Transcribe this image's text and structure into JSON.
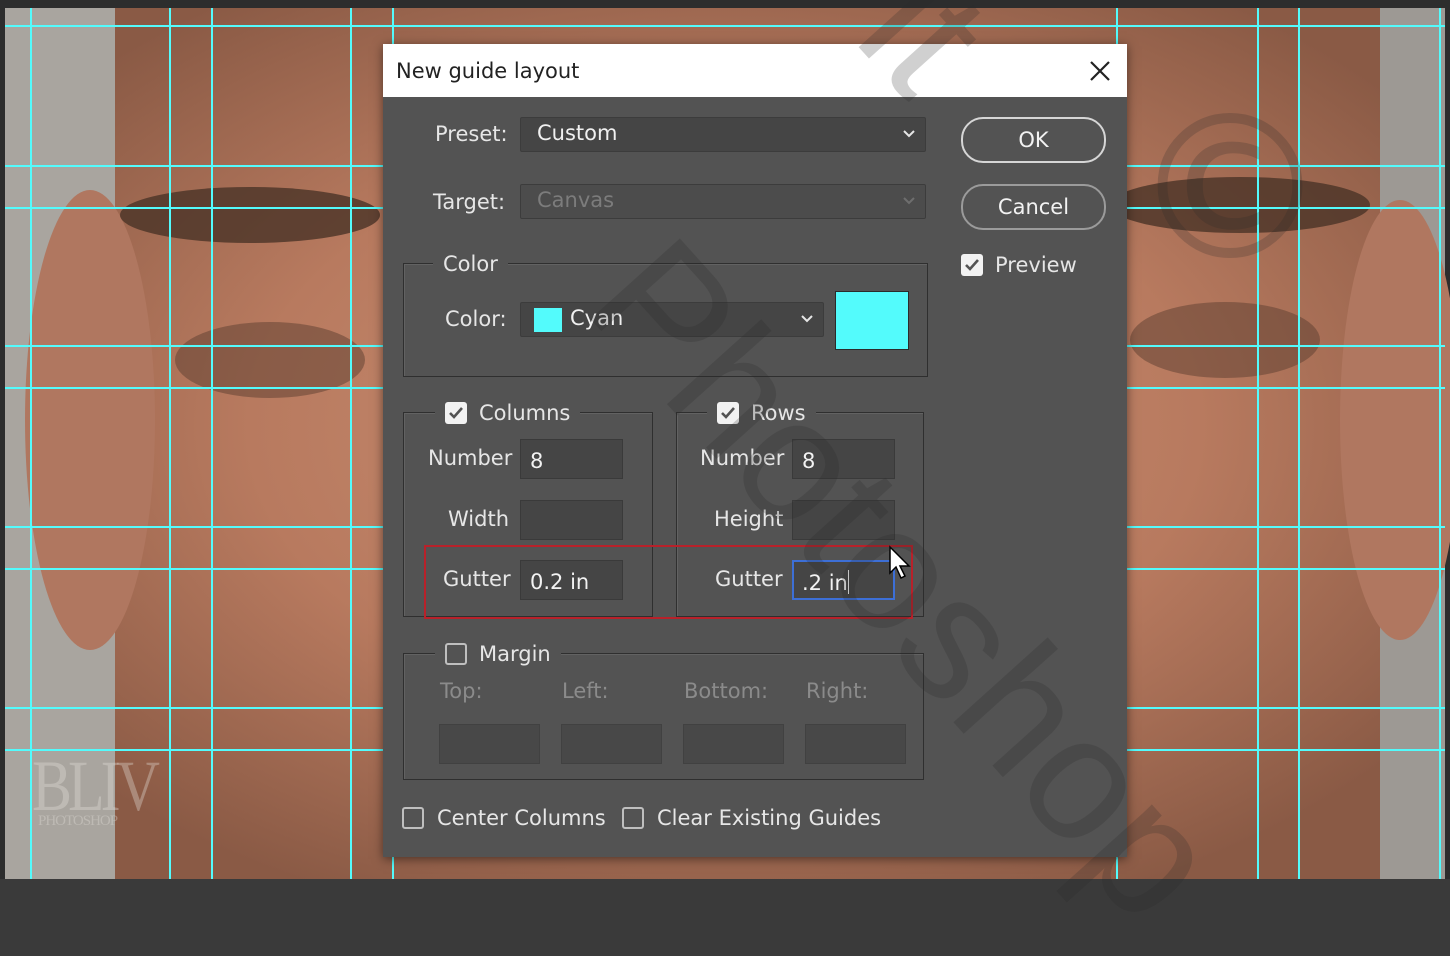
{
  "dialog": {
    "title": "New guide layout",
    "preset": {
      "label": "Preset:",
      "value": "Custom"
    },
    "target": {
      "label": "Target:",
      "value": "Canvas",
      "disabled": true
    },
    "color_group": {
      "legend": "Color",
      "label": "Color:",
      "value": "Cyan",
      "swatch_hex": "#53fbfc"
    },
    "columns": {
      "legend": "Columns",
      "checked": true,
      "number_label": "Number",
      "number_value": "8",
      "width_label": "Width",
      "width_value": "",
      "gutter_label": "Gutter",
      "gutter_value": "0.2 in"
    },
    "rows": {
      "legend": "Rows",
      "checked": true,
      "number_label": "Number",
      "number_value": "8",
      "height_label": "Height",
      "height_value": "",
      "gutter_label": "Gutter",
      "gutter_value": ".2 in"
    },
    "margin": {
      "legend": "Margin",
      "checked": false,
      "top_label": "Top:",
      "left_label": "Left:",
      "bottom_label": "Bottom:",
      "right_label": "Right:"
    },
    "center_columns": {
      "label": "Center Columns",
      "checked": false
    },
    "clear_existing": {
      "label": "Clear Existing Guides",
      "checked": false
    },
    "ok_label": "OK",
    "cancel_label": "Cancel",
    "preview": {
      "label": "Preview",
      "checked": true
    }
  },
  "canvas": {
    "guide_color": "#53fbfc"
  },
  "logo": {
    "line1": "BLIV",
    "line2": "PHOTOSHOP"
  },
  "watermark": {
    "text": "Photoshop",
    "symbol": "©",
    "partial": "lt"
  }
}
